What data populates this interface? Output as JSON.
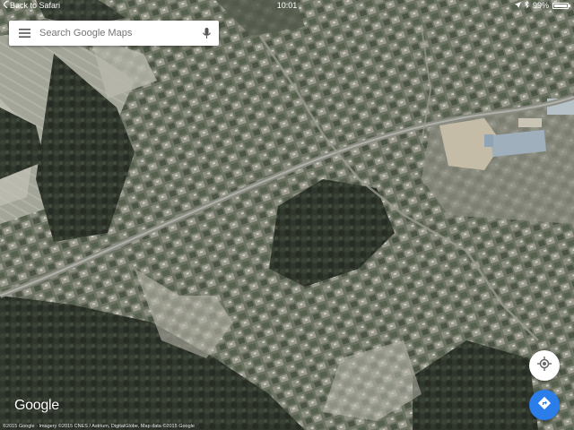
{
  "status_bar": {
    "back_label": "Back to Safari",
    "time": "10:01",
    "battery": "99%",
    "battery_level": 0.99
  },
  "search": {
    "placeholder": "Search Google Maps",
    "menu_icon": "menu-icon",
    "mic_icon": "mic-icon"
  },
  "map": {
    "type": "satellite",
    "logo": "Google",
    "attribution": "©2015 Google · Imagery ©2015 CNES / Astrium, DigitalGlobe, Map data ©2015 Google"
  },
  "controls": {
    "my_location_icon": "my-location-icon",
    "directions_icon": "directions-icon"
  },
  "colors": {
    "directions_fab": "#2b7de9",
    "search_text": "#757575"
  }
}
